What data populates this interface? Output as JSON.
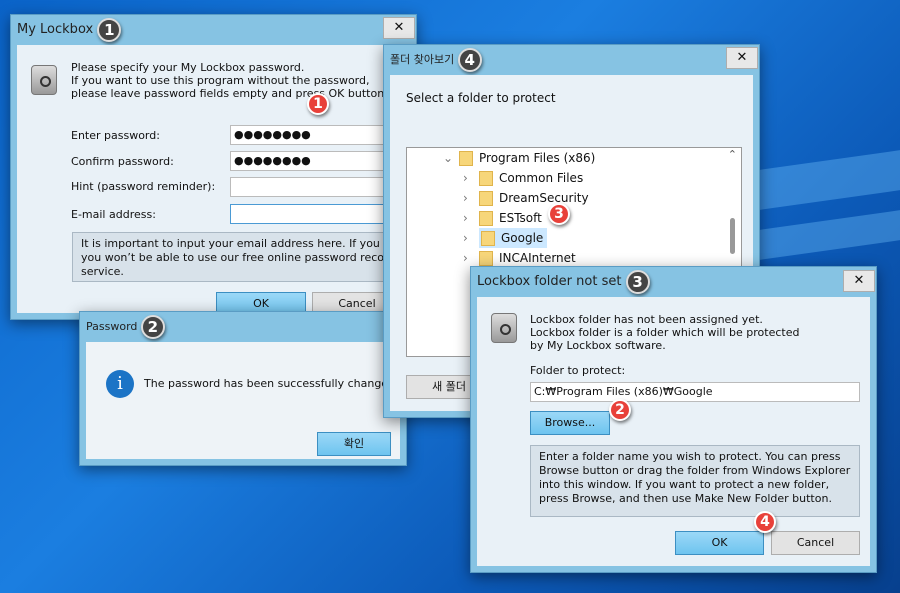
{
  "lockbox": {
    "title": "My Lockbox",
    "step": "1",
    "close": "✕",
    "intro": [
      "Please specify your My Lockbox password.",
      "If you want to use this program without the password,",
      "please leave password fields empty and press OK button."
    ],
    "labels": {
      "password": "Enter password:",
      "confirm": "Confirm password:",
      "hint": "Hint (password reminder):",
      "email": "E-mail address:"
    },
    "values": {
      "password": "●●●●●●●●",
      "confirm": "●●●●●●●●",
      "hint": "",
      "email": ""
    },
    "note": "It is important to input your email address here. If you don’t, you won’t be able to use our free online password recovery service.",
    "ok": "OK",
    "cancel": "Cancel",
    "marker": "1"
  },
  "password_dialog": {
    "title": "Password",
    "step": "2",
    "message": "The password has been successfully changed!",
    "confirm": "확인",
    "info_icon": "i"
  },
  "browse": {
    "title": "폴더 찾아보기",
    "step": "4",
    "close": "✕",
    "prompt": "Select a folder to protect",
    "tree": [
      {
        "label": "Program Files (x86)",
        "expanded": true
      },
      {
        "label": "Common Files"
      },
      {
        "label": "DreamSecurity"
      },
      {
        "label": "ESTsoft"
      },
      {
        "label": "Google",
        "selected": true
      },
      {
        "label": "INCAInternet"
      }
    ],
    "new_folder": "새 폴더 만들기",
    "marker": "3"
  },
  "folder_dialog": {
    "title": "Lockbox folder not set",
    "step": "3",
    "close": "✕",
    "intro": [
      "Lockbox folder has not been assigned yet.",
      "Lockbox folder is a folder which will be protected",
      "by My Lockbox software."
    ],
    "folder_label": "Folder to protect:",
    "folder_value": "C:₩Program Files (x86)₩Google",
    "browse": "Browse...",
    "browse_marker": "2",
    "note": "Enter a folder name you wish to protect. You can press Browse button or drag the folder from Windows Explorer into this window. If you want to protect a new folder, press Browse, and then use Make New Folder button.",
    "ok": "OK",
    "ok_marker": "4",
    "cancel": "Cancel"
  }
}
